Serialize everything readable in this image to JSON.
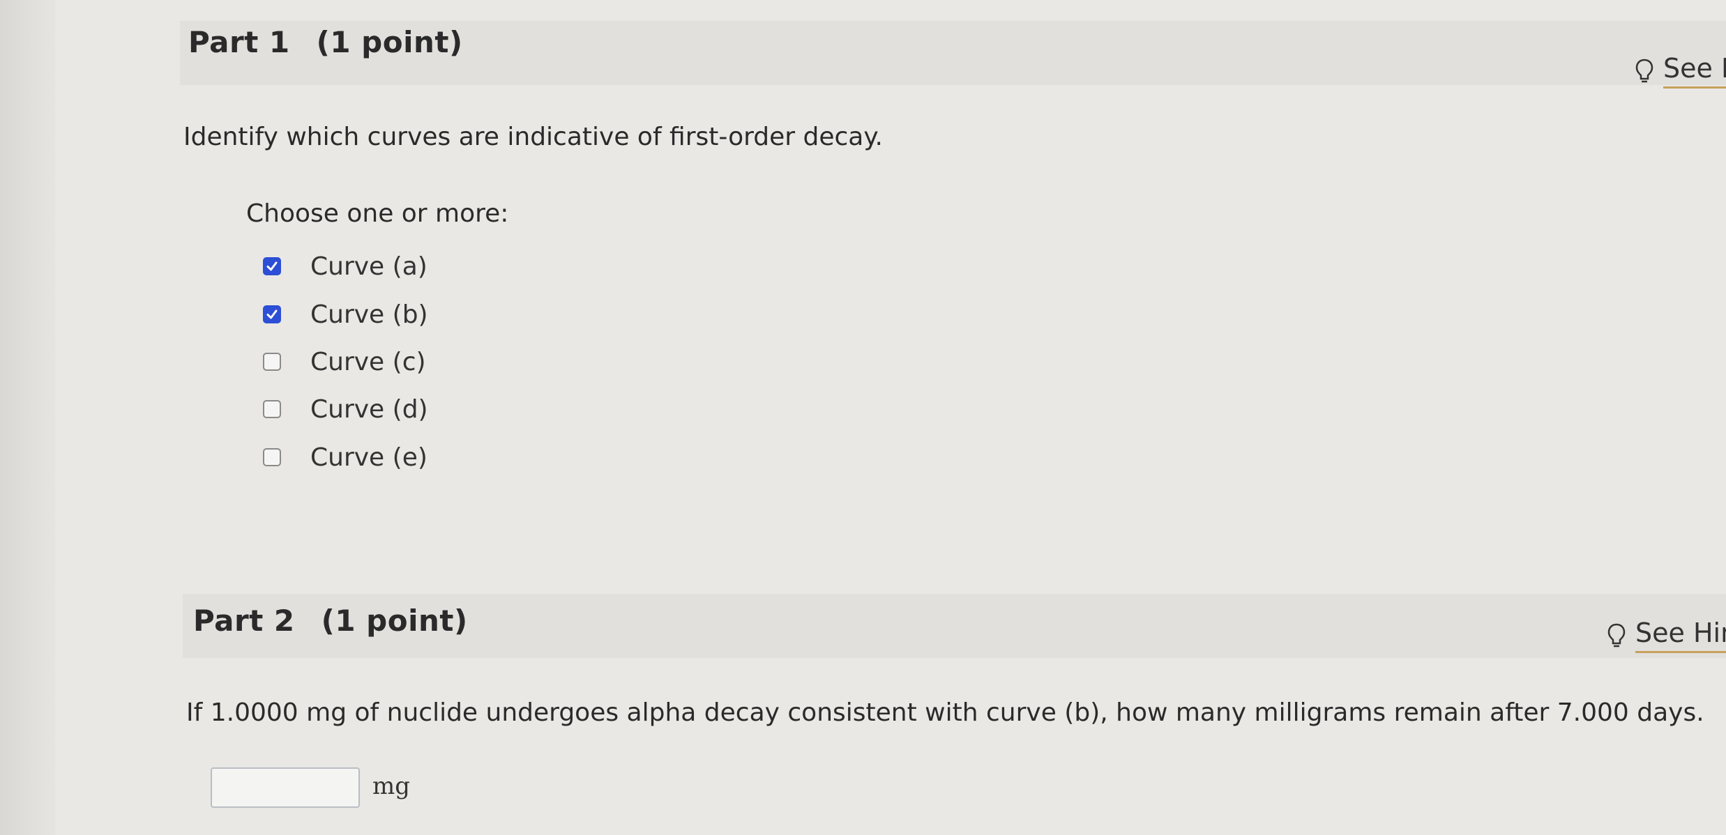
{
  "part1": {
    "title": "Part 1",
    "points": "(1 point)",
    "hint_label": "See H",
    "question": "Identify which curves are indicative of first-order decay.",
    "choose_label": "Choose one or more:",
    "options": [
      {
        "label": "Curve (a)",
        "checked": true
      },
      {
        "label": "Curve (b)",
        "checked": true
      },
      {
        "label": "Curve (c)",
        "checked": false
      },
      {
        "label": "Curve (d)",
        "checked": false
      },
      {
        "label": "Curve (e)",
        "checked": false
      }
    ]
  },
  "part2": {
    "title": "Part 2",
    "points": "(1 point)",
    "hint_label": "See Hin",
    "question": "If 1.0000 mg of nuclide undergoes alpha decay consistent with curve (b), how many milligrams remain after 7.000 days.",
    "answer_value": "",
    "unit": "mg"
  },
  "colors": {
    "checkbox_checked": "#2d4fd6",
    "hint_underline": "#c7a15c"
  },
  "icons": {
    "hint": "lightbulb-icon",
    "check": "checkmark-icon"
  }
}
